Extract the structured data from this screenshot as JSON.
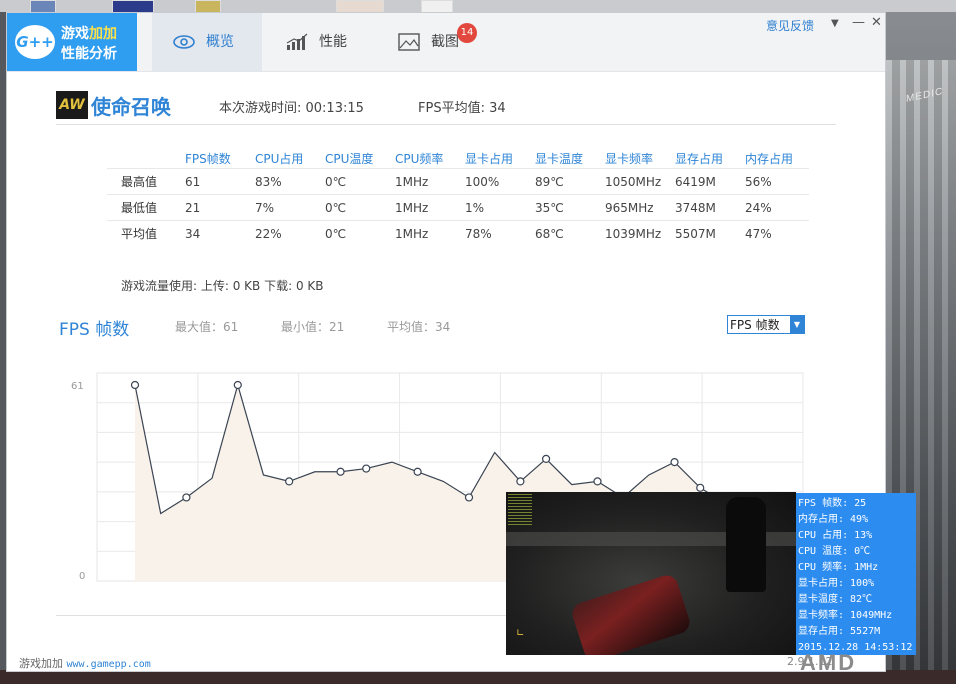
{
  "app": {
    "logo_line1_a": "游戏",
    "logo_line1_b": "加加",
    "logo_line2": "性能分析",
    "logo_mark": "G++",
    "feedback": "意见反馈",
    "tabs": [
      {
        "label": "概览",
        "icon": "eye-icon",
        "active": true
      },
      {
        "label": "性能",
        "icon": "chart-icon",
        "active": false
      },
      {
        "label": "截图",
        "icon": "picture-icon",
        "active": false,
        "badge": "14"
      }
    ],
    "colors": {
      "accent": "#2f9df0",
      "badge": "#e2483d"
    }
  },
  "game": {
    "name": "使命召唤",
    "icon_text": "AW",
    "play_time": "本次游戏时间: 00:13:15",
    "fps_avg": "FPS平均值: 34"
  },
  "stats": {
    "headers": [
      "FPS帧数",
      "CPU占用",
      "CPU温度",
      "CPU频率",
      "显卡占用",
      "显卡温度",
      "显卡频率",
      "显存占用",
      "内存占用"
    ],
    "rows": [
      {
        "label": "最高值",
        "values": [
          "61",
          "83%",
          "0℃",
          "1MHz",
          "100%",
          "89℃",
          "1050MHz",
          "6419M",
          "56%"
        ]
      },
      {
        "label": "最低值",
        "values": [
          "21",
          "7%",
          "0℃",
          "1MHz",
          "1%",
          "35℃",
          "965MHz",
          "3748M",
          "24%"
        ]
      },
      {
        "label": "平均值",
        "values": [
          "34",
          "22%",
          "0℃",
          "1MHz",
          "78%",
          "68℃",
          "1039MHz",
          "5507M",
          "47%"
        ]
      }
    ]
  },
  "traffic": "游戏流量使用: 上传: 0 KB    下载: 0 KB",
  "fps_section": {
    "title": "FPS 帧数",
    "max": "最大值：61",
    "min": "最小值：21",
    "avg": "平均值：34",
    "select_value": "FPS 帧数"
  },
  "chart_data": {
    "type": "area",
    "yticks": [
      "61",
      "0"
    ],
    "ylim": [
      0,
      61
    ],
    "x": [
      0,
      1,
      2,
      3,
      4,
      5,
      6,
      7,
      8,
      9,
      10,
      11,
      12,
      13,
      14,
      15,
      16,
      17,
      18,
      19,
      20,
      21,
      22,
      23,
      24,
      25,
      26
    ],
    "values": [
      61,
      21,
      26,
      32,
      61,
      33,
      31,
      34,
      34,
      35,
      37,
      34,
      31,
      26,
      40,
      31,
      38,
      30,
      31,
      26,
      33,
      37,
      29,
      24,
      26,
      26,
      26
    ]
  },
  "footer": {
    "app_name": "游戏加加",
    "url": "www.gamepp.com",
    "version": "2.9.1.12"
  },
  "osd": {
    "lines": [
      "FPS 帧数: 25",
      "内存占用: 49%",
      "CPU 占用: 13%",
      "CPU 温度: 0℃",
      "CPU 频率: 1MHz",
      "显卡占用: 100%",
      "显卡温度: 82℃",
      "显卡频率: 1049MHz",
      "显存占用: 5527M",
      "2015.12.28 14:53:12"
    ]
  },
  "desktop": {
    "sign": "MEDIC",
    "amd": "AMD"
  }
}
